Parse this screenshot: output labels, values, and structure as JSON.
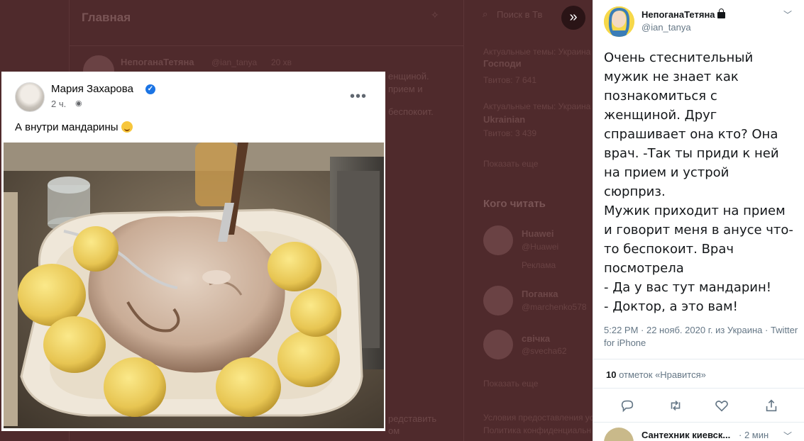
{
  "background": {
    "home_title": "Главная",
    "feed_author": "НепоганаТетяна",
    "feed_handle": "@ian_tanya",
    "feed_time": "20 хв",
    "feed_snip1": "енщиной.",
    "feed_snip2": "прием и",
    "feed_snip3": "беспокоит.",
    "search_placeholder": "Поиск в Тв",
    "trend1_label": "Актуальные темы: Украина",
    "trend1_title": "Господи",
    "trend1_count": "Твитов: 7 641",
    "trend2_label": "Актуальные темы: Украина",
    "trend2_title": "Ukrainian",
    "trend2_count": "Твитов: 3 439",
    "show_more": "Показать еще",
    "who_to_follow": "Кого читать",
    "follow1_name": "Huawei",
    "follow1_handle": "@Huawei",
    "follow1_tag": "Реклама",
    "follow2_name": "Поганка",
    "follow2_handle": "@marchenko578",
    "follow3_name": "свічка",
    "follow3_handle": "@svecha62",
    "show_more2": "Показать еще",
    "footer1": "Условия предоставления ус",
    "footer2": "Политика конфиденциальн",
    "feed_bottom1": "редставить",
    "feed_bottom2": "ом"
  },
  "fb_post": {
    "author": "Мария Захарова",
    "time": "2 ч.",
    "caption": "А внутри мандарины",
    "more_icon": "more-horizontal-icon"
  },
  "tweet": {
    "author": "НепоганаТетяна",
    "handle": "@ian_tanya",
    "body": "Очень стеснительный\nмужик не знает как\nпознакомиться с\nженщиной. Друг\nспрашивает она кто? Она\nврач. -Так ты приди к ней\nна прием и устрой\nсюрприз.\nМужик приходит на прием\nи говорит меня в анусе что-\nто беспокоит. Врач\nпосмотрела\n- Да у вас тут мандарин!\n- Доктор, а это вам!",
    "meta": "5:22 PM · 22 нояб. 2020 г. из Украина · Twitter for iPhone",
    "likes_count": "10",
    "likes_label": "отметок «Нравится»",
    "reply_author": "Сантехник киевск...",
    "reply_time": "· 2 мин"
  },
  "colors": {
    "overlay_bg": "#4f2a2c",
    "twitter_blue": "#1da1f2",
    "text_secondary": "#657786",
    "fb_verified": "#1b74e4"
  }
}
